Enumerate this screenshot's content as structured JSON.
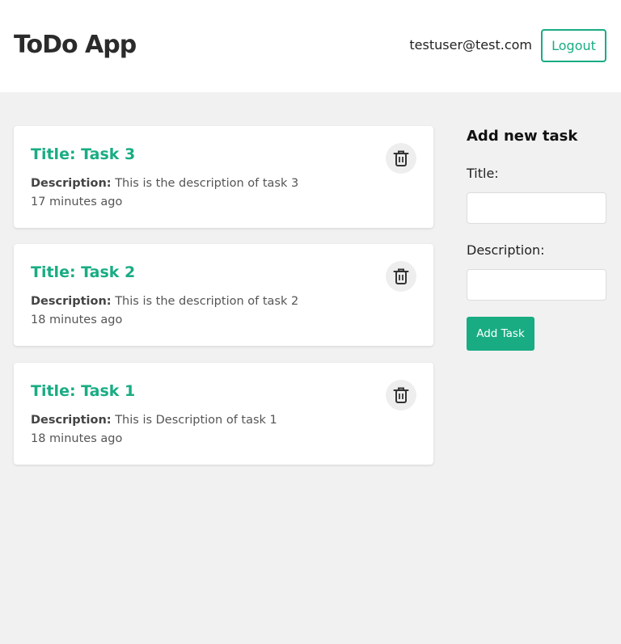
{
  "header": {
    "app_title": "ToDo App",
    "user_email": "testuser@test.com",
    "logout_label": "Logout"
  },
  "tasks": [
    {
      "title": "Title: Task 3",
      "desc_label": "Description:",
      "desc_text": " This is the description of task 3",
      "time": "17 minutes ago"
    },
    {
      "title": "Title: Task 2",
      "desc_label": "Description:",
      "desc_text": " This is the description of task 2",
      "time": "18 minutes ago"
    },
    {
      "title": "Title: Task 1",
      "desc_label": "Description:",
      "desc_text": " This is Description of task 1",
      "time": "18 minutes ago"
    }
  ],
  "form": {
    "heading": "Add new task",
    "title_label": "Title:",
    "title_value": "",
    "description_label": "Description:",
    "description_value": "",
    "submit_label": "Add Task"
  },
  "icons": {
    "delete": "trash-icon"
  },
  "colors": {
    "accent": "#19ac83",
    "header_bg": "#ffffff",
    "page_bg": "#f1f1f1"
  }
}
